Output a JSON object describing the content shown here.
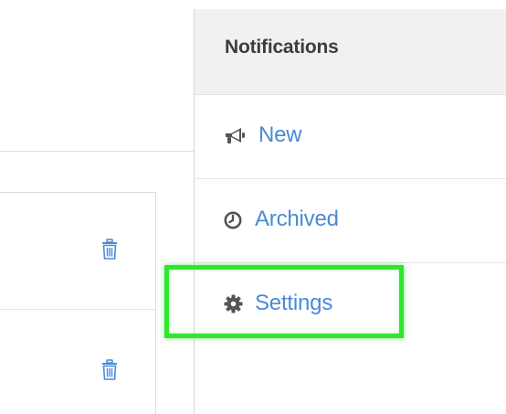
{
  "panel": {
    "title": "Notifications",
    "items": [
      {
        "label": "New",
        "icon": "megaphone-icon"
      },
      {
        "label": "Archived",
        "icon": "clock-icon"
      },
      {
        "label": "Settings",
        "icon": "gear-icon"
      }
    ]
  },
  "left_table": {
    "rows": [
      {
        "action_icon": "trash-icon"
      },
      {
        "action_icon": "trash-icon"
      }
    ]
  },
  "colors": {
    "link": "#4a8ad8",
    "header_bg": "#f1f1f1",
    "header_text": "#3d3d3d",
    "highlight": "#2ee62e",
    "icon": "#555555"
  }
}
